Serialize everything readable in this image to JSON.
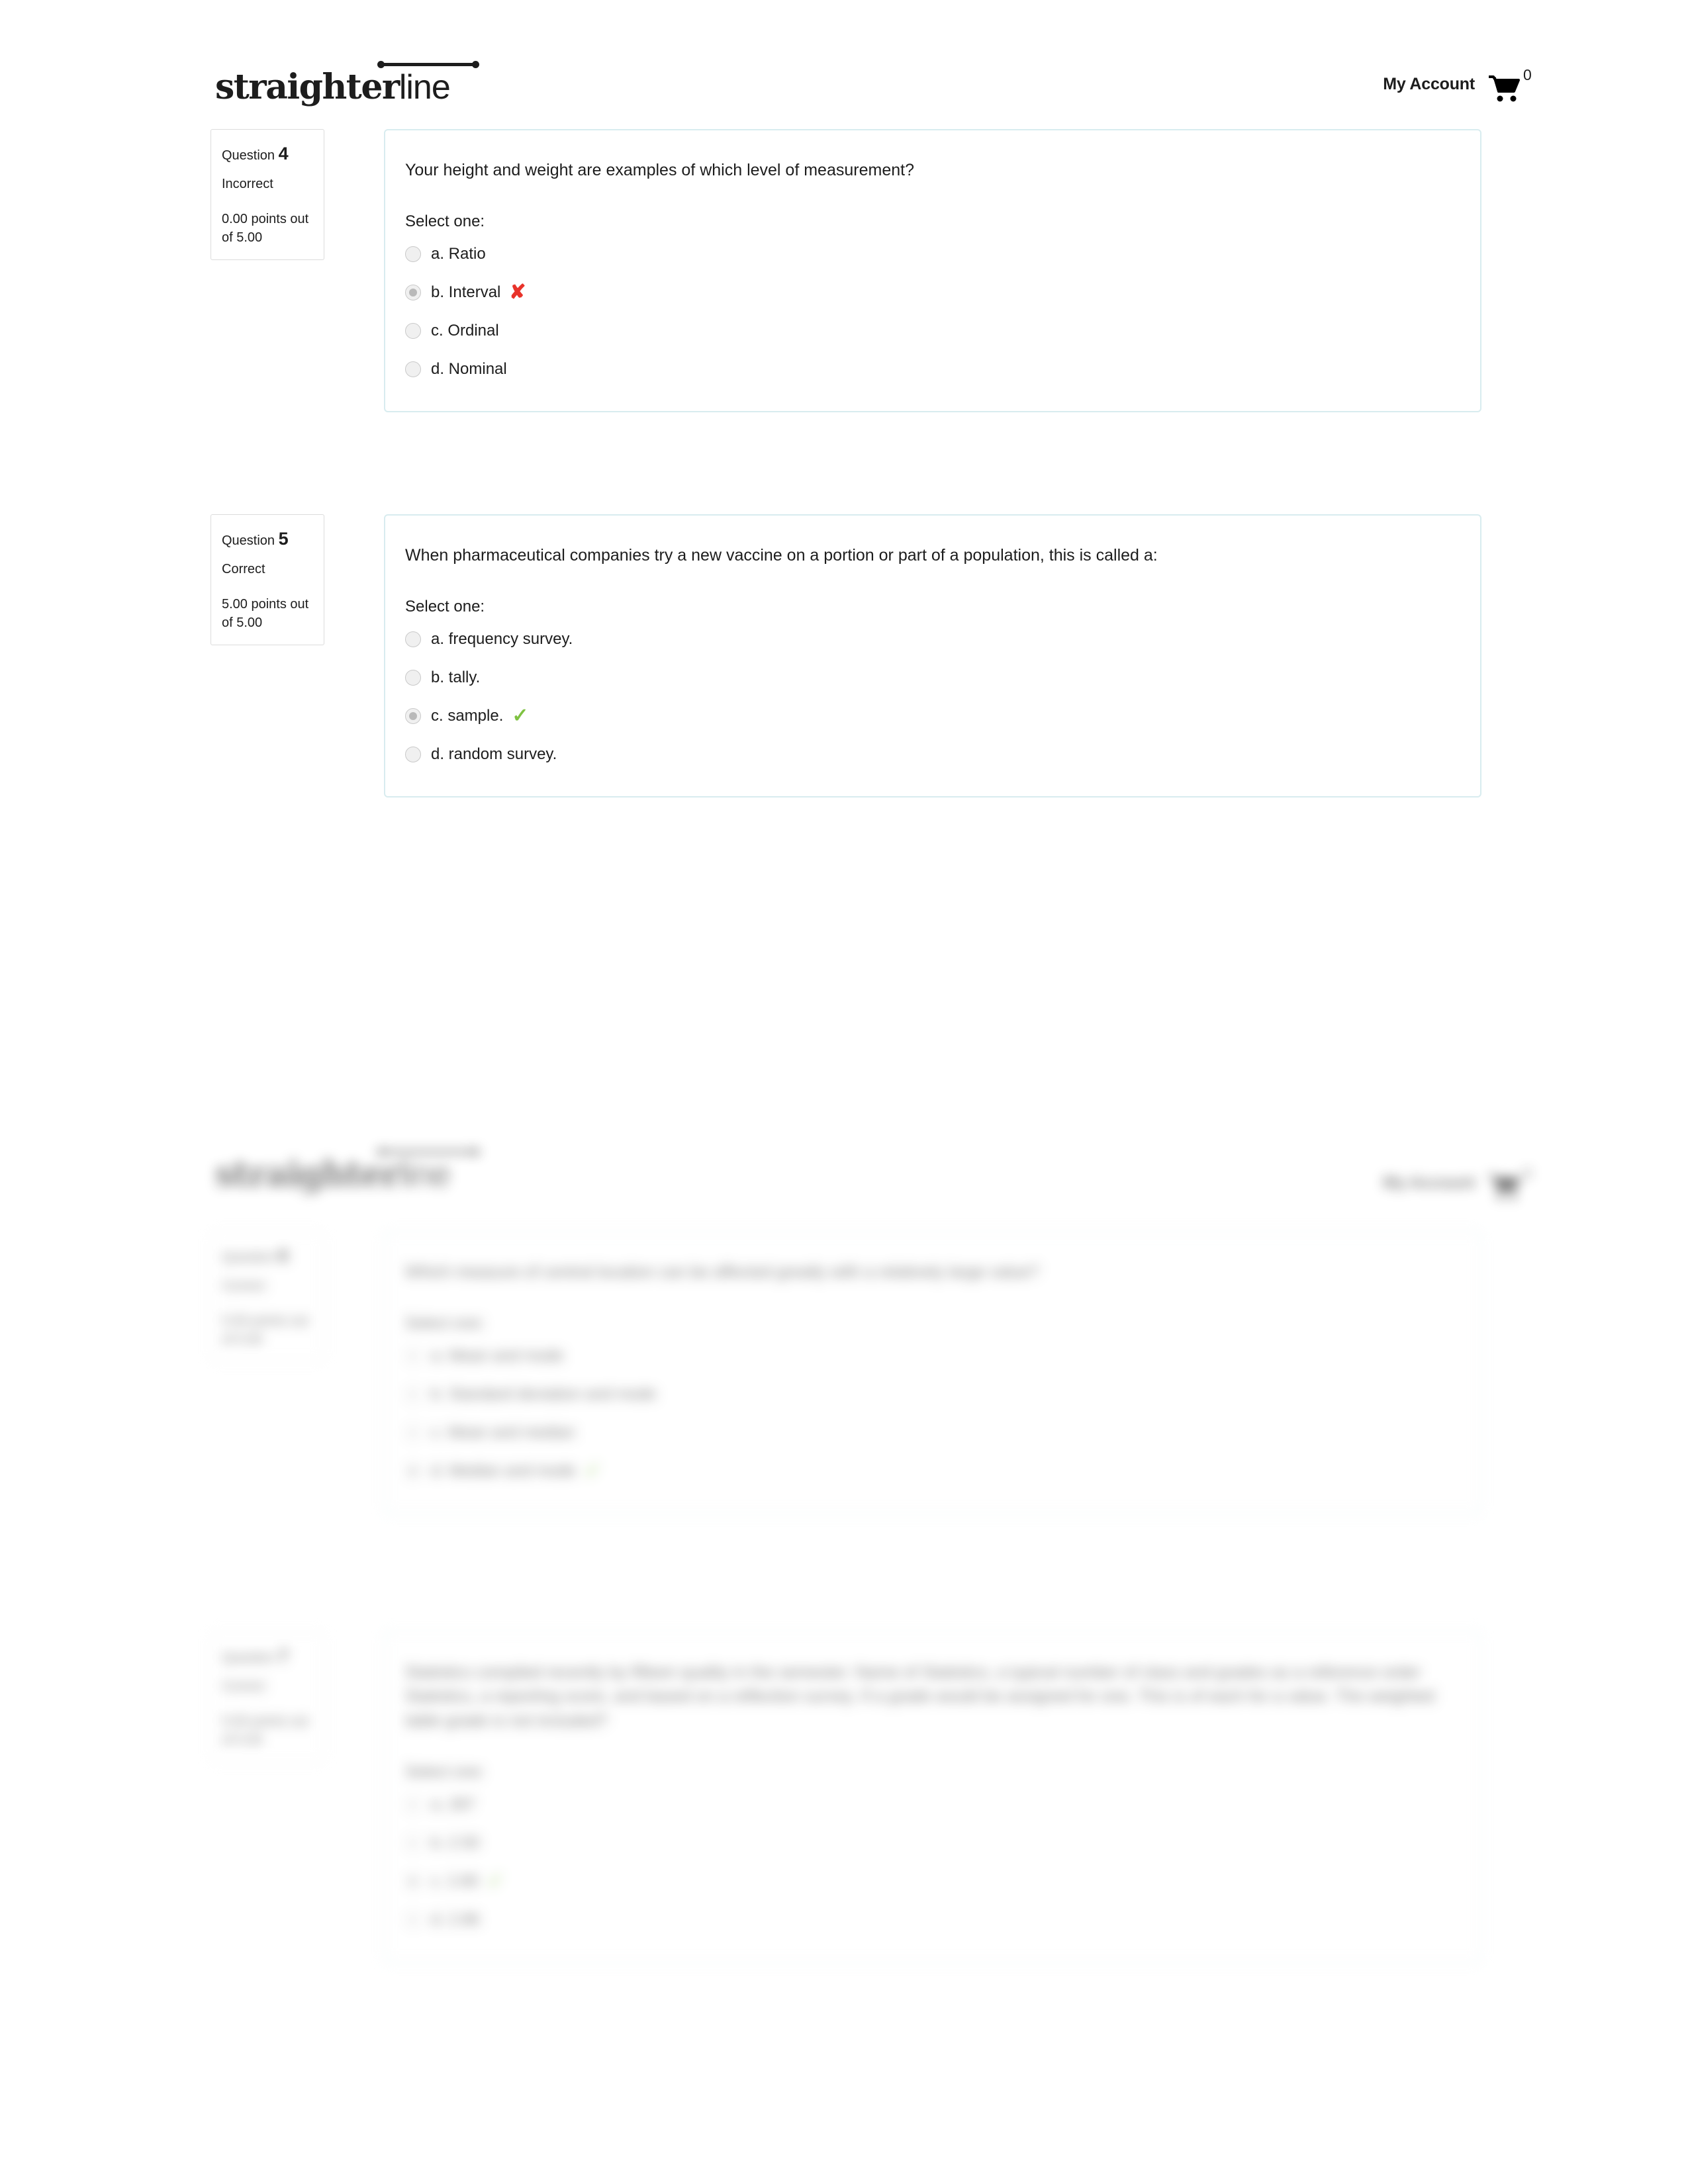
{
  "header": {
    "logo_bold": "straighter",
    "logo_light": "line",
    "my_account": "My Account",
    "cart_icon": "shopping-cart-icon",
    "cart_count": "0"
  },
  "colors": {
    "card_border": "#d8ecef",
    "info_border": "#dcdcdc",
    "wrong": "#e8332a",
    "correct": "#7fc242",
    "text": "#1d1d1d"
  },
  "questions": [
    {
      "label": "Question",
      "number": "4",
      "state": "Incorrect",
      "grade": "0.00 points out of 5.00",
      "text": "Your height and weight are examples of which level of measurement?",
      "select_one": "Select one:",
      "options": [
        {
          "label": "a. Ratio",
          "selected": false,
          "mark": ""
        },
        {
          "label": "b. Interval",
          "selected": true,
          "mark": "✘"
        },
        {
          "label": "c. Ordinal",
          "selected": false,
          "mark": ""
        },
        {
          "label": "d. Nominal",
          "selected": false,
          "mark": ""
        }
      ]
    },
    {
      "label": "Question",
      "number": "5",
      "state": "Correct",
      "grade": "5.00 points out of 5.00",
      "text": "When pharmaceutical companies try a new vaccine on a portion or part of a population, this is called a:",
      "select_one": "Select one:",
      "options": [
        {
          "label": "a. frequency survey.",
          "selected": false,
          "mark": ""
        },
        {
          "label": "b. tally.",
          "selected": false,
          "mark": ""
        },
        {
          "label": "c. sample.",
          "selected": true,
          "mark": "✓"
        },
        {
          "label": "d. random survey.",
          "selected": false,
          "mark": ""
        }
      ]
    }
  ],
  "blurred_section": {
    "description": "out-of-focus duplicate of the quiz page below the fold",
    "header": {
      "logo_bold": "straighter",
      "logo_light": "line",
      "my_account": "My Account",
      "cart_count": "0"
    },
    "questions": [
      {
        "label": "Question",
        "number": "6",
        "state": "Correct",
        "grade": "5.00 points out of 5.00",
        "text": "Which measure of central location can be affected greatly with a relatively large value?",
        "select_one": "Select one:",
        "options": [
          {
            "label": "a. Mean and mode",
            "selected": false,
            "mark": ""
          },
          {
            "label": "b. Standard deviation and mode",
            "selected": false,
            "mark": ""
          },
          {
            "label": "c. Mean and median",
            "selected": false,
            "mark": ""
          },
          {
            "label": "d. Median and mode",
            "selected": true,
            "mark": "✓"
          }
        ]
      },
      {
        "label": "Question",
        "number": "7",
        "state": "Correct",
        "grade": "5.00 points out of 5.00",
        "text": "Statistics compiled recently by fifteen quality in the semester. Name of Statistics, a typical number of class and grades as a reference order Statistics, a reporting score, and based on a reflection survey. If a grade would be assigned for one. This is of each for a value. The weighted table grade is not included?",
        "select_one": "Select one:",
        "options": [
          {
            "label": "a. 287",
            "selected": false,
            "mark": ""
          },
          {
            "label": "b. 2.50",
            "selected": false,
            "mark": ""
          },
          {
            "label": "c. 2.80",
            "selected": true,
            "mark": "✓"
          },
          {
            "label": "d. 2.86",
            "selected": false,
            "mark": ""
          }
        ]
      }
    ]
  }
}
